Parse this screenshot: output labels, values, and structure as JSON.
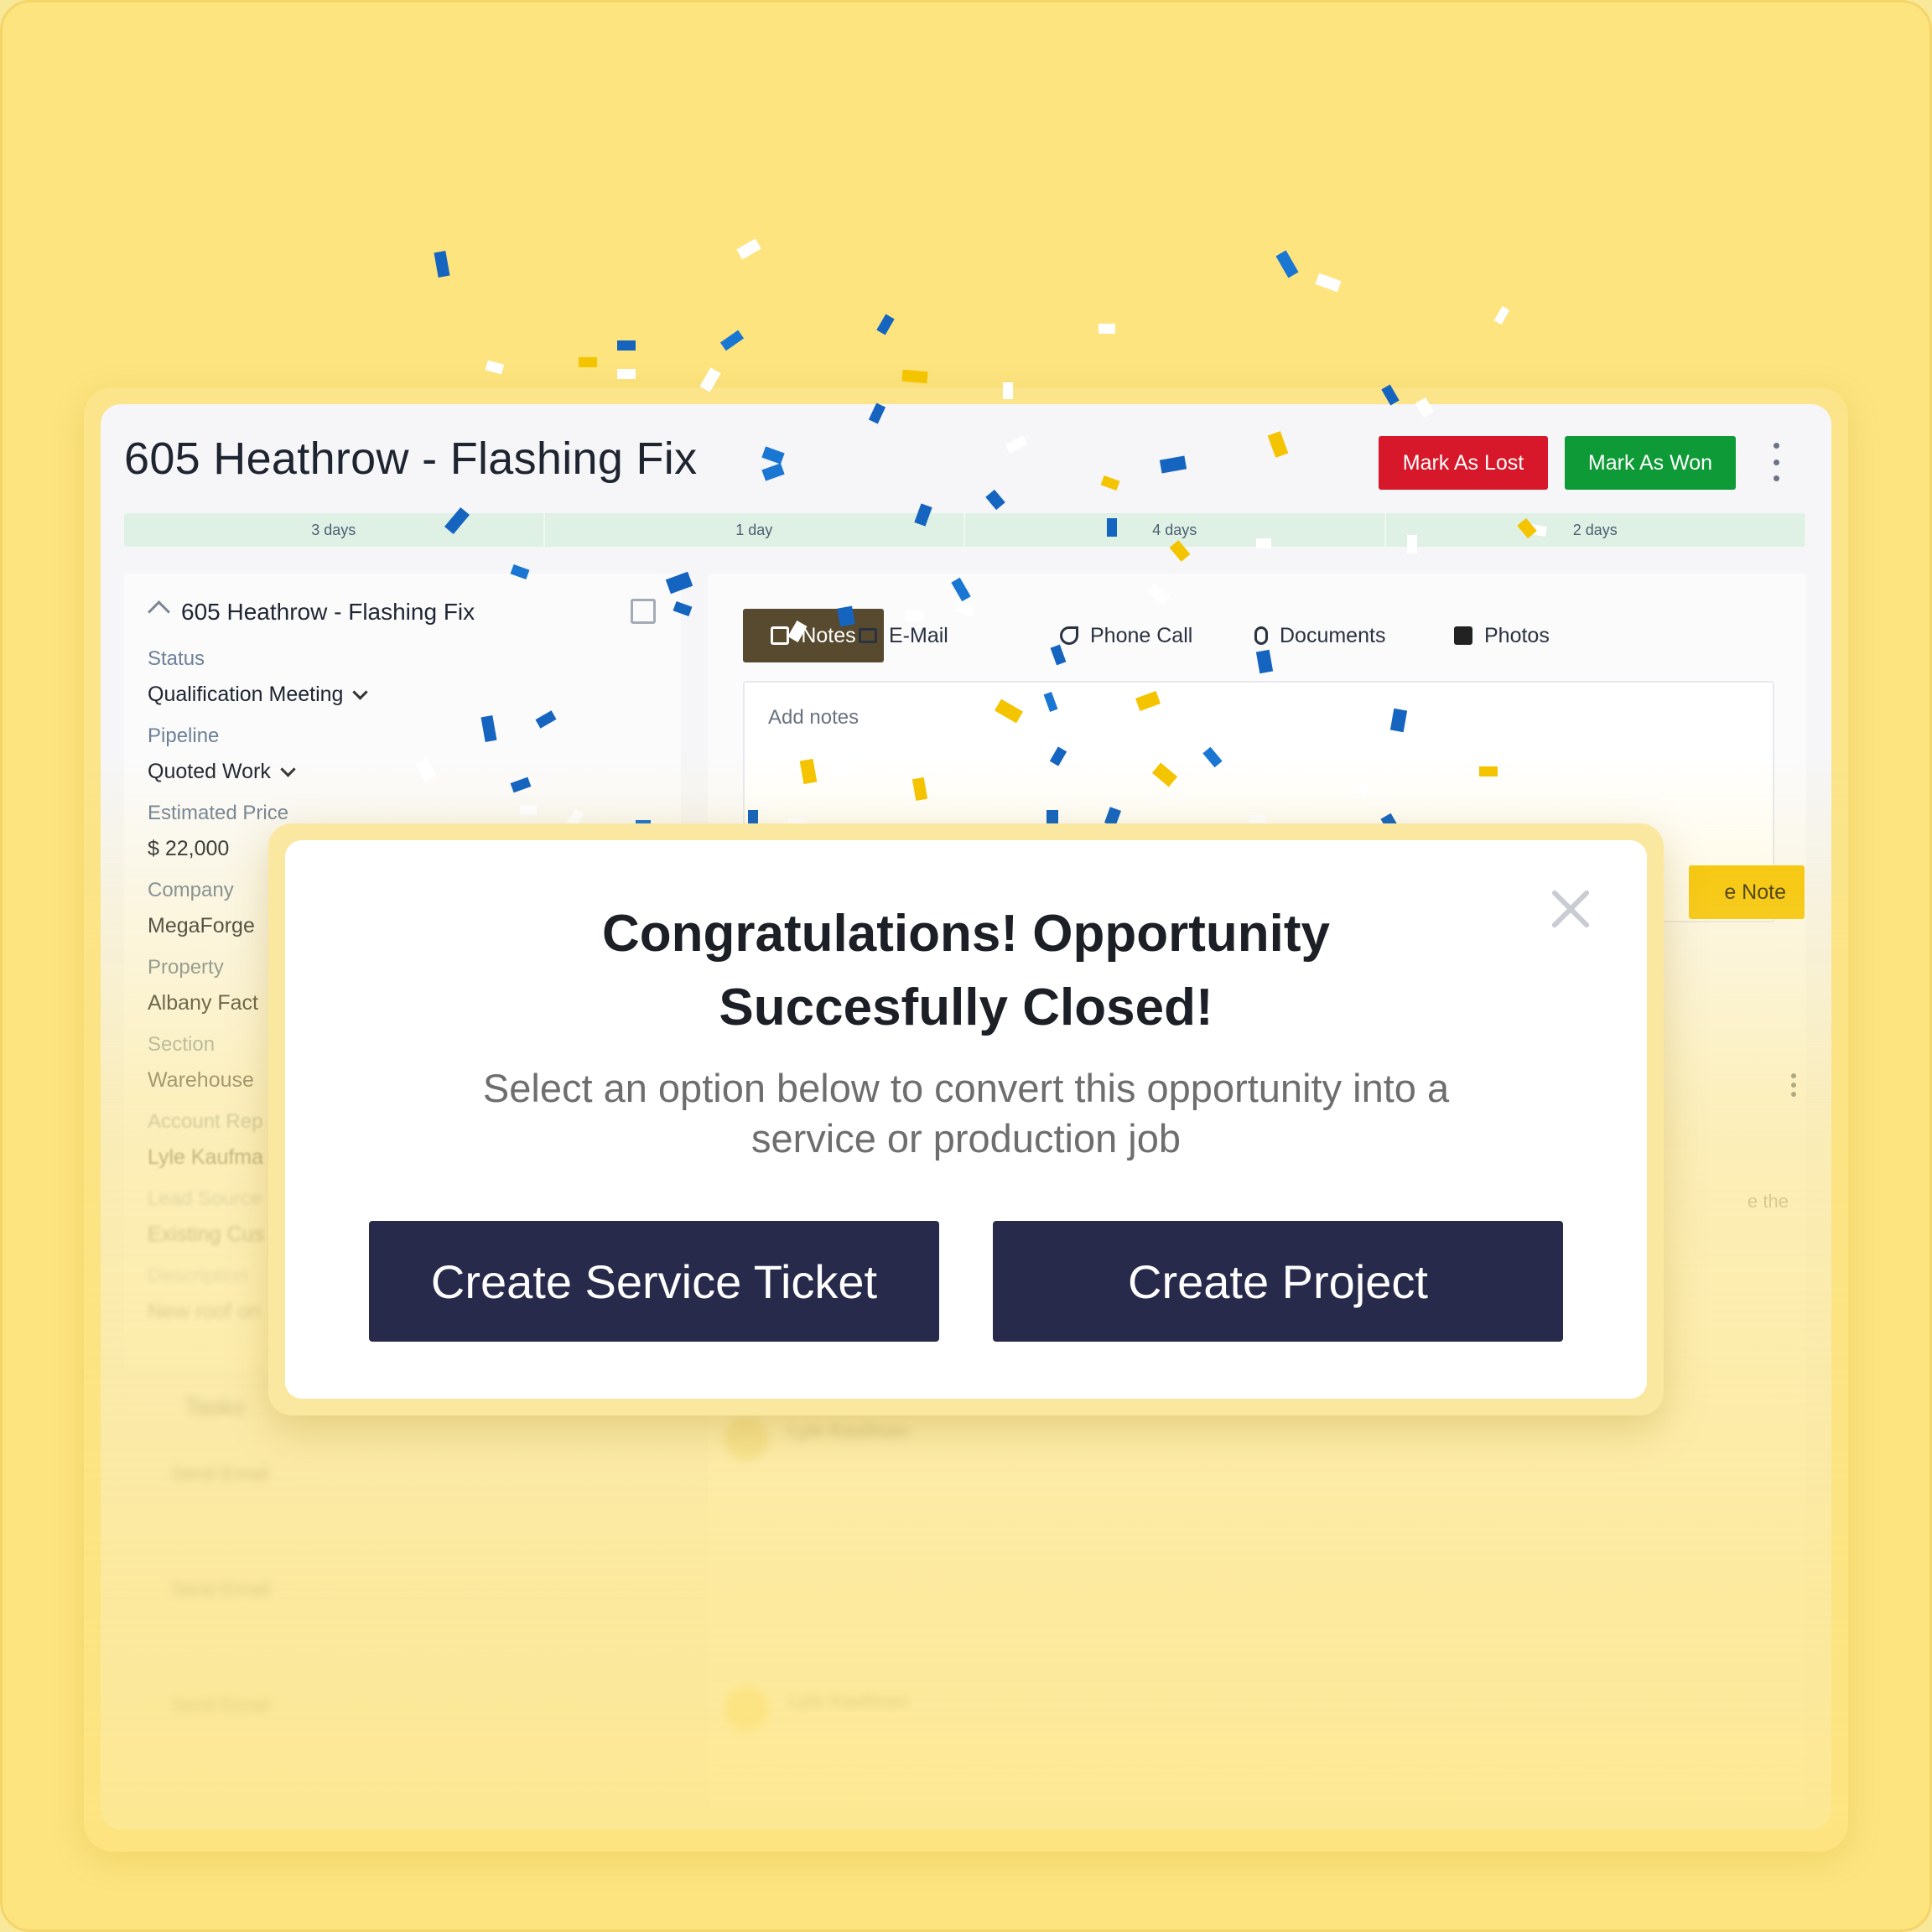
{
  "header": {
    "title": "605 Heathrow - Flashing Fix",
    "mark_lost": "Mark As Lost",
    "mark_won": "Mark As Won"
  },
  "stages": [
    "3 days",
    "1 day",
    "4 days",
    "2 days"
  ],
  "details": {
    "heading": "605 Heathrow - Flashing Fix",
    "fields": [
      {
        "label": "Status",
        "value": "Qualification Meeting"
      },
      {
        "label": "Pipeline",
        "value": "Quoted Work"
      },
      {
        "label": "Estimated Price",
        "value": "$ 22,000"
      },
      {
        "label": "Company",
        "value": "MegaForge"
      },
      {
        "label": "Property",
        "value": "Albany Fact"
      },
      {
        "label": "Section",
        "value": "Warehouse"
      },
      {
        "label": "Account Rep",
        "value": "Lyle Kaufma"
      },
      {
        "label": "Lead Source",
        "value": "Existing Cus"
      },
      {
        "label": "Description",
        "value": "New roof on"
      }
    ]
  },
  "tasks": {
    "heading": "Tasks",
    "items": [
      {
        "title": "Send Email"
      },
      {
        "title": "Send Email"
      },
      {
        "title": "Send Email"
      }
    ]
  },
  "tabs": [
    "Notes",
    "E-Mail",
    "Phone Call",
    "Documents",
    "Photos"
  ],
  "notes": {
    "placeholder": "Add notes",
    "save_label": "e Note"
  },
  "activity": {
    "author": "Lyle Kaufman",
    "partial_text": "e the"
  },
  "modal": {
    "title": "Congratulations! Opportunity Succesfully Closed!",
    "subtitle": "Select an option below to convert this opportunity into a service or production job",
    "service_button": "Create Service Ticket",
    "project_button": "Create Project"
  },
  "colors": {
    "background": "#fde47f",
    "lost": "#d7182a",
    "won": "#0e9a36",
    "active_tab": "#584a2e",
    "save": "#f5c400",
    "modal_button": "#272a4a"
  }
}
